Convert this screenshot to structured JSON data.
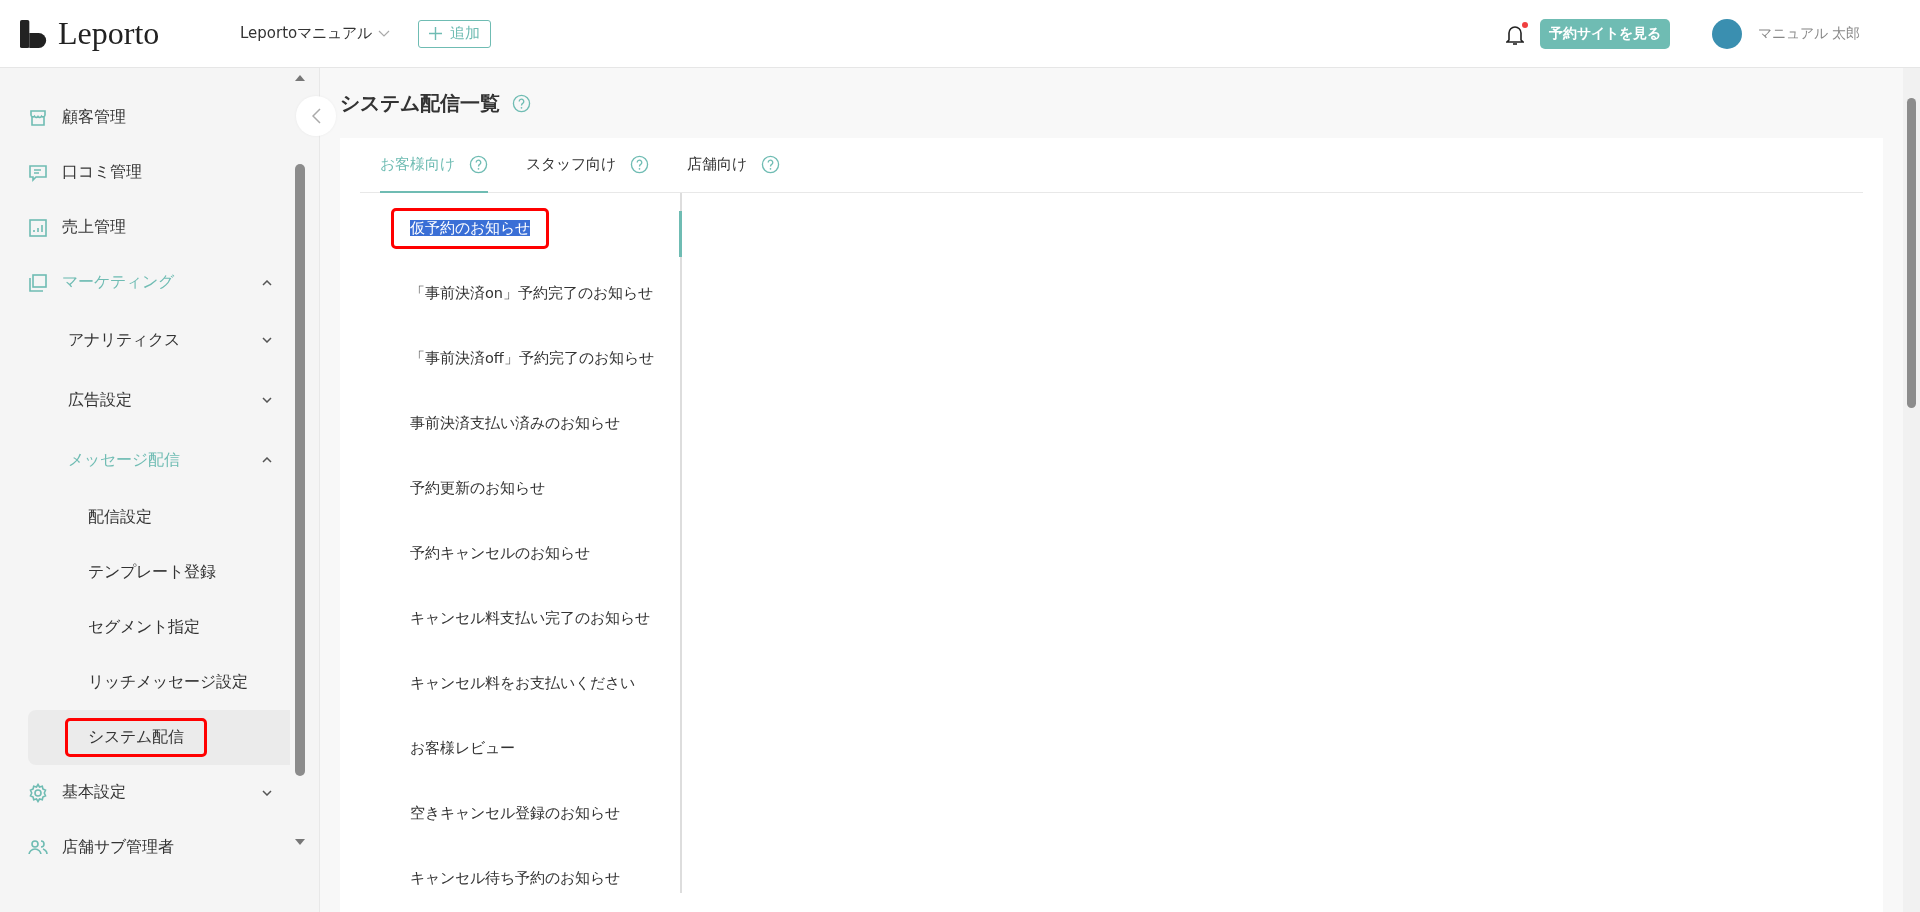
{
  "header": {
    "logo": "Leporto",
    "store_selector": "Leportoマニュアル",
    "add_button": "追加",
    "notification_dot": true,
    "site_button": "予約サイトを見る",
    "user_name": "マニュアル 太郎"
  },
  "sidebar": {
    "items": [
      {
        "label": "顧客管理",
        "active": false
      },
      {
        "label": "口コミ管理",
        "active": false
      },
      {
        "label": "売上管理",
        "active": false
      },
      {
        "label": "マーケティング",
        "expanded": true,
        "active": true,
        "children": [
          {
            "label": "アナリティクス",
            "expanded": false,
            "active": false
          },
          {
            "label": "広告設定",
            "expanded": false,
            "active": false
          },
          {
            "label": "メッセージ配信",
            "expanded": true,
            "active": true,
            "children": [
              {
                "label": "配信設定",
                "selected": false,
                "highlighted": false
              },
              {
                "label": "テンプレート登録",
                "selected": false,
                "highlighted": false
              },
              {
                "label": "セグメント指定",
                "selected": false,
                "highlighted": false
              },
              {
                "label": "リッチメッセージ設定",
                "selected": false,
                "highlighted": false
              },
              {
                "label": "システム配信",
                "selected": true,
                "highlighted": true
              }
            ]
          }
        ]
      },
      {
        "label": "基本設定",
        "expanded": false,
        "active": false
      },
      {
        "label": "店舗サブ管理者",
        "active": false
      }
    ]
  },
  "page_title": "システム配信一覧",
  "tabs": [
    {
      "label": "お客様向け",
      "selected": true
    },
    {
      "label": "スタッフ向け",
      "selected": false
    },
    {
      "label": "店舗向け",
      "selected": false
    }
  ],
  "notifications": [
    {
      "label": "仮予約のお知らせ",
      "selected": true,
      "highlighted": true
    },
    {
      "label": "「事前決済on」予約完了のお知らせ",
      "selected": false,
      "highlighted": false
    },
    {
      "label": "「事前決済off」予約完了のお知らせ",
      "selected": false,
      "highlighted": false
    },
    {
      "label": "事前決済支払い済みのお知らせ",
      "selected": false,
      "highlighted": false
    },
    {
      "label": "予約更新のお知らせ",
      "selected": false,
      "highlighted": false
    },
    {
      "label": "予約キャンセルのお知らせ",
      "selected": false,
      "highlighted": false
    },
    {
      "label": "キャンセル料支払い完了のお知らせ",
      "selected": false,
      "highlighted": false
    },
    {
      "label": "キャンセル料をお支払いください",
      "selected": false,
      "highlighted": false
    },
    {
      "label": "お客様レビュー",
      "selected": false,
      "highlighted": false
    },
    {
      "label": "空きキャンセル登録のお知らせ",
      "selected": false,
      "highlighted": false
    },
    {
      "label": "キャンセル待ち予約のお知らせ",
      "selected": false,
      "highlighted": false
    }
  ]
}
